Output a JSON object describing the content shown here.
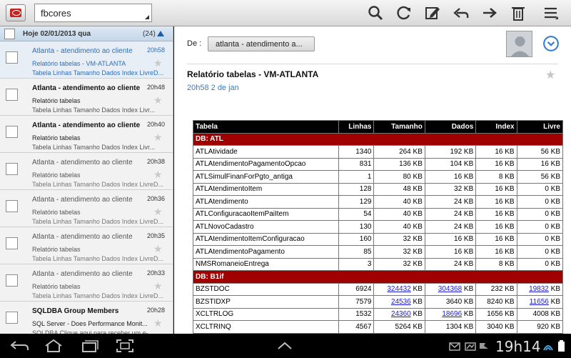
{
  "account": {
    "name": "fbcores"
  },
  "list_header": {
    "label": "Hoje  02/01/2013 qua",
    "count": "(24)"
  },
  "messages": [
    {
      "from": "Atlanta - atendimento ao cliente",
      "time": "20h58",
      "subject": "Relatório tabelas - VM-ATLANTA",
      "snippet": "Tabela Linhas Tamanho Dados Index LivreD...",
      "state": "selected"
    },
    {
      "from": "Atlanta - atendimento ao cliente",
      "time": "20h48",
      "subject": "Relatório tabelas",
      "snippet": "Tabela Linhas Tamanho Dados Index Livr...",
      "state": "unread"
    },
    {
      "from": "Atlanta - atendimento ao cliente",
      "time": "20h40",
      "subject": "Relatório tabelas",
      "snippet": "Tabela Linhas Tamanho Dados Index Livr...",
      "state": "unread"
    },
    {
      "from": "Atlanta - atendimento ao cliente",
      "time": "20h38",
      "subject": "Relatório tabelas",
      "snippet": "Tabela Linhas Tamanho Dados Index LivreD...",
      "state": "read"
    },
    {
      "from": "Atlanta - atendimento ao cliente",
      "time": "20h36",
      "subject": "Relatório tabelas",
      "snippet": "Tabela Linhas Tamanho Dados Index LivreD...",
      "state": "read"
    },
    {
      "from": "Atlanta - atendimento ao cliente",
      "time": "20h35",
      "subject": "Relatório tabelas",
      "snippet": "Tabela Linhas Tamanho Dados Index LivreD...",
      "state": "read"
    },
    {
      "from": "Atlanta - atendimento ao cliente",
      "time": "20h33",
      "subject": "Relatório tabelas",
      "snippet": "Tabela Linhas Tamanho Dados Index LivreD...",
      "state": "read"
    },
    {
      "from": "SQLDBA Group Members",
      "time": "20h28",
      "subject": "SQL Server - Does Performance Monit...",
      "snippet": "SQLDBA Clique aqui para receber um e-...",
      "state": "unread"
    }
  ],
  "reader": {
    "from_label": "De :",
    "from_chip": "atlanta - atendimento a...",
    "subject": "Relatório tabelas - VM-ATLANTA",
    "date": "20h58 2 de jan",
    "table": {
      "headers": [
        "Tabela",
        "Linhas",
        "Tamanho",
        "Dados",
        "Index",
        "Livre"
      ],
      "groups": [
        {
          "label": "DB: ATL",
          "rows": [
            [
              "ATLAtividade",
              "1340",
              "264 KB",
              "192 KB",
              "16 KB",
              "56 KB"
            ],
            [
              "ATLAtendimentoPagamentoOpcao",
              "831",
              "136 KB",
              "104 KB",
              "16 KB",
              "16 KB"
            ],
            [
              "ATLSimulFinanForPgto_antiga",
              "1",
              "80 KB",
              "16 KB",
              "8 KB",
              "56 KB"
            ],
            [
              "ATLAtendimentoItem",
              "128",
              "48 KB",
              "32 KB",
              "16 KB",
              "0 KB"
            ],
            [
              "ATLAtendimento",
              "129",
              "40 KB",
              "24 KB",
              "16 KB",
              "0 KB"
            ],
            [
              "ATLConfiguracaoItemPaiItem",
              "54",
              "40 KB",
              "24 KB",
              "16 KB",
              "0 KB"
            ],
            [
              "ATLNovoCadastro",
              "130",
              "40 KB",
              "24 KB",
              "16 KB",
              "0 KB"
            ],
            [
              "ATLAtendimentoItemConfiguracao",
              "160",
              "32 KB",
              "16 KB",
              "16 KB",
              "0 KB"
            ],
            [
              "ATLAtendimentoPagamento",
              "85",
              "32 KB",
              "16 KB",
              "16 KB",
              "0 KB"
            ],
            [
              "NMSRomaneioEntrega",
              "3",
              "32 KB",
              "24 KB",
              "8 KB",
              "0 KB"
            ]
          ]
        },
        {
          "label": "DB: B1if",
          "rows": [
            [
              "BZSTDOC",
              "6924",
              "324432 KB",
              "304368 KB",
              "232 KB",
              "19832 KB"
            ],
            [
              "BZSTIDXP",
              "7579",
              "24536 KB",
              "3640 KB",
              "8240 KB",
              "11656 KB"
            ],
            [
              "XCLTRLOG",
              "1532",
              "24360 KB",
              "18696 KB",
              "1656 KB",
              "4008 KB"
            ],
            [
              "XCLTRINQ",
              "4567",
              "5264 KB",
              "1304 KB",
              "3040 KB",
              "920 KB"
            ]
          ]
        }
      ],
      "linked_cells": [
        "324432",
        "304368",
        "19832",
        "24536",
        "11656",
        "24360",
        "18696"
      ]
    }
  },
  "system": {
    "clock": "19h14"
  },
  "colors": {
    "accent": "#2a7fd0",
    "group_header": "#a00000"
  }
}
